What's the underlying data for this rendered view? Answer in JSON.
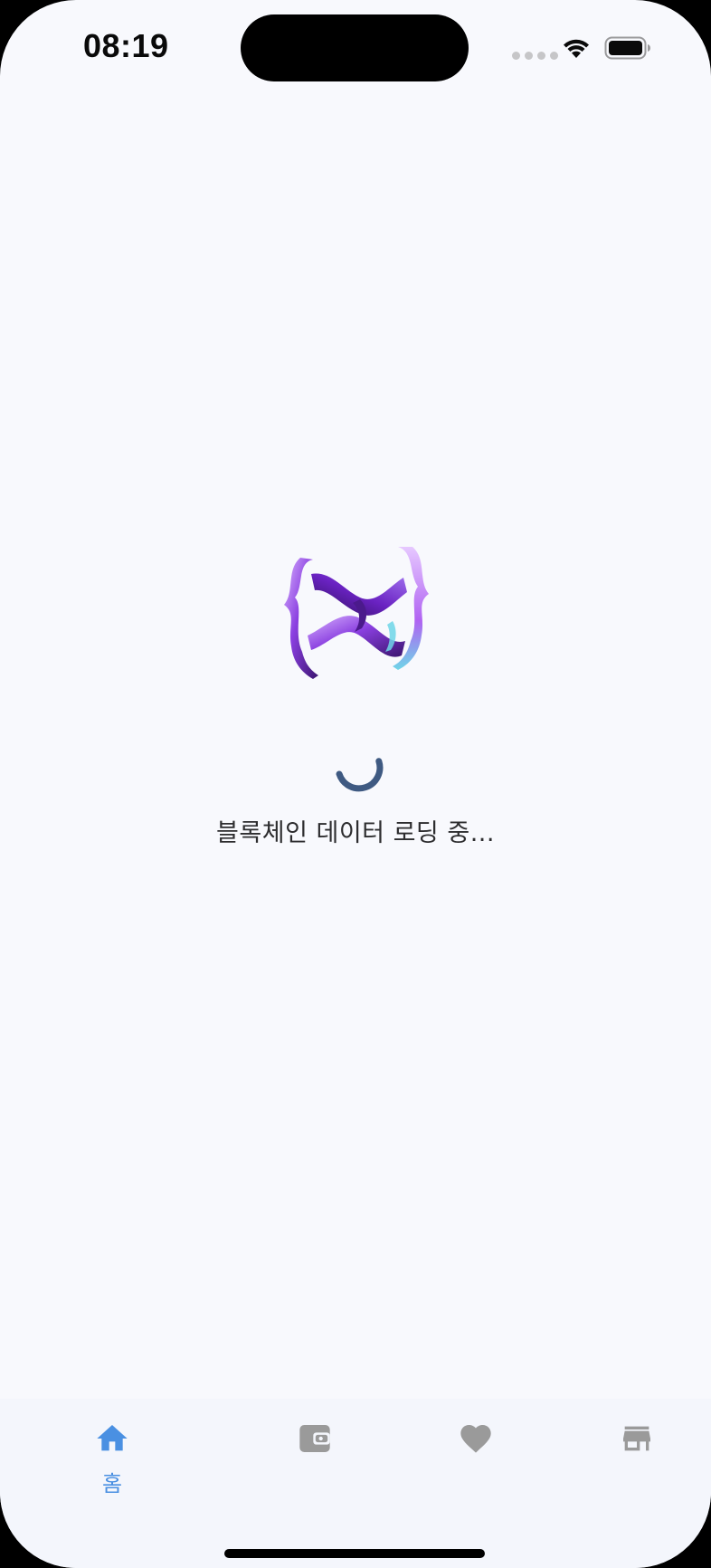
{
  "status_bar": {
    "time": "08:19"
  },
  "loading": {
    "message": "블록체인 데이터 로딩 중..."
  },
  "tab_bar": {
    "active_color": "#4a90e2",
    "inactive_color": "#9a9a9a",
    "items": [
      {
        "icon": "home-icon",
        "label": "홈",
        "active": true
      },
      {
        "icon": "wallet-icon",
        "label": "",
        "active": false
      },
      {
        "icon": "heart-icon",
        "label": "",
        "active": false
      },
      {
        "icon": "store-icon",
        "label": "",
        "active": false
      }
    ]
  },
  "colors": {
    "background": "#f8f9fd",
    "spinner": "#3f5a82",
    "logo_primary": "#7a2fd1",
    "logo_highlight": "#d9b4ff",
    "logo_accent": "#6fd6e8"
  }
}
